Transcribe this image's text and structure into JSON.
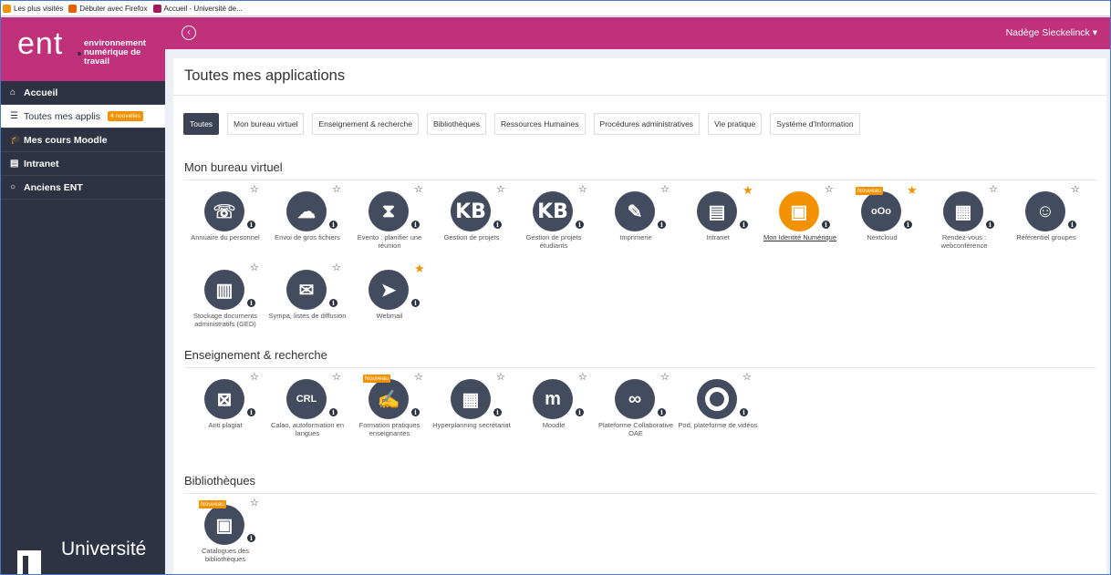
{
  "bookmarks": [
    {
      "label": "Les plus visités",
      "color": "#f39200"
    },
    {
      "label": "Débuter avec Firefox",
      "color": "#e66000"
    },
    {
      "label": "Accueil - Université de...",
      "color": "#a3195b"
    }
  ],
  "brand": {
    "big": "ent",
    "sub": "environnement numérique de travail"
  },
  "nav": [
    {
      "label": "Accueil",
      "icon": "home-icon",
      "glyph": "⌂"
    },
    {
      "label": "Toutes mes applis",
      "icon": "list-icon",
      "glyph": "☰",
      "badge": "4 nouvelles",
      "active": true
    },
    {
      "label": "Mes cours Moodle",
      "icon": "graduation-cap-icon",
      "glyph": "🎓"
    },
    {
      "label": "Intranet",
      "icon": "document-icon",
      "glyph": "▤"
    },
    {
      "label": "Anciens ENT",
      "icon": "circle-icon",
      "glyph": "○"
    }
  ],
  "university": "Université",
  "topbar": {
    "back": "‹",
    "user": "Nadège Sieckelinck ▾"
  },
  "page_title": "Toutes mes applications",
  "filters": [
    "Toutes",
    "Mon bureau virtuel",
    "Enseignement & recherche",
    "Bibliothèques",
    "Ressources Humaines",
    "Procédures administratives",
    "Vie pratique",
    "Système d'Information"
  ],
  "sections": [
    {
      "title": "Mon bureau virtuel",
      "apps": [
        {
          "label": "Annuaire du personnel",
          "icon": "phonebook-icon",
          "glyph": "☏"
        },
        {
          "label": "Envoi de gros fichiers",
          "icon": "cloud-upload-icon",
          "glyph": "☁"
        },
        {
          "label": "Evento : planifier une réunion",
          "icon": "hourglass-icon",
          "glyph": "⧗"
        },
        {
          "label": "Gestion de projets",
          "icon": "kanboard-icon",
          "glyph": "KB"
        },
        {
          "label": "Gestion de projets étudiants",
          "icon": "kanboard-icon",
          "glyph": "KB"
        },
        {
          "label": "Imprimerie",
          "icon": "edit-icon",
          "glyph": "✎"
        },
        {
          "label": "Intranet",
          "icon": "newspaper-icon",
          "glyph": "▤",
          "fav": true
        },
        {
          "label": "Mon Identité Numérique",
          "icon": "id-card-icon",
          "glyph": "▣",
          "orange": true,
          "link": true
        },
        {
          "label": "Nextcloud",
          "icon": "nextcloud-icon",
          "glyph": "oOo",
          "fav": true,
          "new": "Nouveau"
        },
        {
          "label": "Rendez-vous : webconférence",
          "icon": "calendar-icon",
          "glyph": "▦"
        },
        {
          "label": "Référentiel groupes",
          "icon": "users-icon",
          "glyph": "☺"
        },
        {
          "label": "Stockage documents administratifs (GED)",
          "icon": "binders-icon",
          "glyph": "▥"
        },
        {
          "label": "Sympa, listes de diffusion",
          "icon": "envelope-icon",
          "glyph": "✉"
        },
        {
          "label": "Webmail",
          "icon": "paper-plane-icon",
          "glyph": "➤",
          "fav": true
        }
      ]
    },
    {
      "title": "Enseignement & recherche",
      "apps": [
        {
          "label": "Anti plagiat",
          "icon": "plagiarism-icon",
          "glyph": "⊠"
        },
        {
          "label": "Calao, autoformation en langues",
          "icon": "crl-icon",
          "glyph": "CRL"
        },
        {
          "label": "Formation pratiques enseignantes",
          "icon": "teacher-icon",
          "glyph": "✍",
          "new": "Nouveau"
        },
        {
          "label": "Hyperplanning secrétariat",
          "icon": "calendar-icon",
          "glyph": "▦"
        },
        {
          "label": "Moodle",
          "icon": "moodle-icon",
          "glyph": "m"
        },
        {
          "label": "Plateforme Collaborative OAE",
          "icon": "oae-icon",
          "glyph": "∞"
        },
        {
          "label": "Pod, plateforme de vidéos",
          "icon": "pod-icon",
          "glyph": "",
          "ring": true
        }
      ]
    },
    {
      "title": "Bibliothèques",
      "apps": [
        {
          "label": "Catalogues des bibliothèques",
          "icon": "book-icon",
          "glyph": "▣",
          "new": "Nouveau"
        }
      ]
    }
  ]
}
